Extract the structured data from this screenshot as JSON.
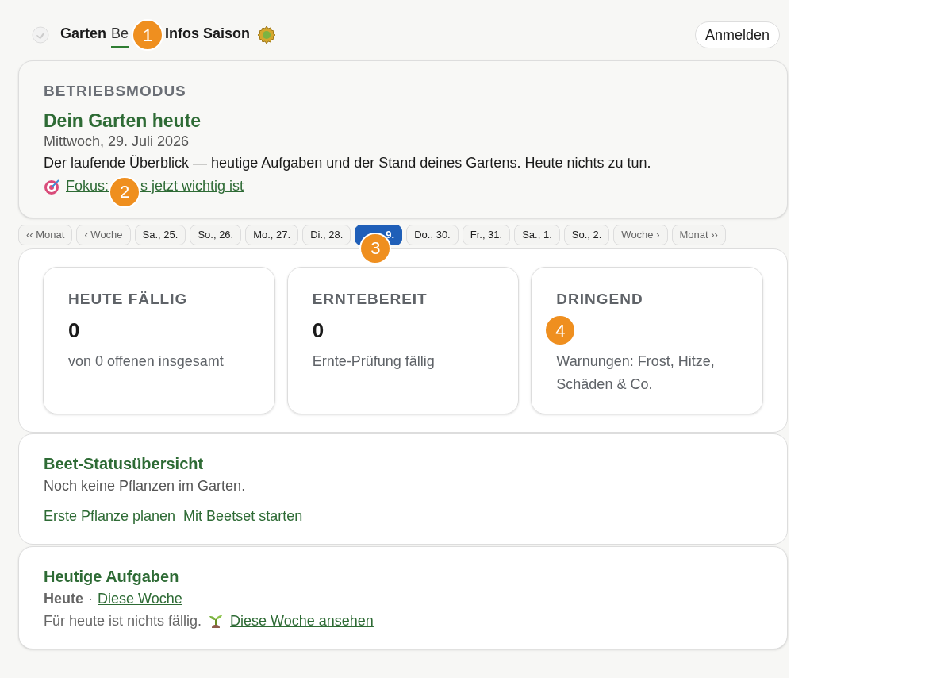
{
  "nav": {
    "items": [
      {
        "kind": "link",
        "label": "Garten",
        "selected": false
      },
      {
        "kind": "link",
        "label": "Be",
        "selected": true
      },
      {
        "kind": "marker",
        "label": "1"
      },
      {
        "kind": "link",
        "label": "Infos Saison",
        "selected": false
      }
    ],
    "login": "Anmelden"
  },
  "hero": {
    "eyebrow": "BETRIEBSMODUS",
    "title": "Dein Garten heute",
    "date": "Mittwoch, 29. Juli 2026",
    "text": "Der laufende Überblick — heutige Aufgaben und der Stand deines Gartens. Heute nichts zu tun.",
    "focus": [
      {
        "kind": "link",
        "label": "Fokus:"
      },
      {
        "kind": "marker",
        "label": "2"
      },
      {
        "kind": "link",
        "label": "s jetzt wichtig ist"
      }
    ]
  },
  "days": [
    {
      "kind": "nav",
      "label": "‹‹ Monat",
      "selected": false
    },
    {
      "kind": "nav",
      "label": "‹ Woche",
      "selected": false
    },
    {
      "kind": "day",
      "label": "Sa., 25.",
      "selected": false
    },
    {
      "kind": "day",
      "label": "So., 26.",
      "selected": false
    },
    {
      "kind": "day",
      "label": "Mo., 27.",
      "selected": false
    },
    {
      "kind": "day",
      "label": "Di., 28.",
      "selected": false
    },
    {
      "kind": "day",
      "label": "9.",
      "selected": true,
      "marker": "3"
    },
    {
      "kind": "day",
      "label": "Do., 30.",
      "selected": false
    },
    {
      "kind": "day",
      "label": "Fr., 31.",
      "selected": false
    },
    {
      "kind": "day",
      "label": "Sa., 1.",
      "selected": false
    },
    {
      "kind": "day",
      "label": "So., 2.",
      "selected": false
    },
    {
      "kind": "nav",
      "label": "Woche ›",
      "selected": false
    },
    {
      "kind": "nav",
      "label": "Monat ››",
      "selected": false
    }
  ],
  "stats": [
    {
      "title": "HEUTE FÄLLIG",
      "value": "0",
      "text": "von 0 offenen insgesamt"
    },
    {
      "title": "ERNTEBEREIT",
      "value": "0",
      "text": "Ernte-Prüfung fällig"
    },
    {
      "title": "DRINGEND",
      "marker": "4",
      "text": "Warnungen: Frost, Hitze, Schäden & Co."
    }
  ],
  "beds": {
    "title": "Beet-Statusübersicht",
    "text": "Noch keine Pflanzen im Garten.",
    "links": [
      "Erste Pflanze planen",
      "Mit Beetset starten"
    ]
  },
  "tasks": {
    "title": "Heutige Aufgaben",
    "tabs": [
      {
        "label": "Heute",
        "selected": true
      },
      {
        "label": "Diese Woche",
        "selected": false
      }
    ],
    "separator": "·",
    "text": "Für heute ist nichts fällig.",
    "link": "Diese Woche ansehen"
  }
}
